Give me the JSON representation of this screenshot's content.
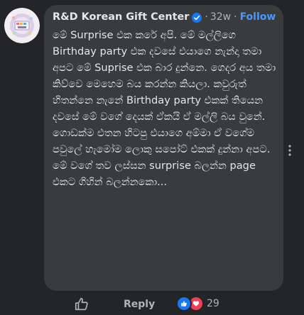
{
  "comment": {
    "author": "R&D Korean Gift Center",
    "separator": "·",
    "time_ago": "32w",
    "follow_label": "Follow",
    "text": "මේ Surprise එක කරේ අපි. මේ මල්ලිගෙ Birthday party එක දවසේ එයාගෙ නැන්දා තමා අපට මේ Suprise එක බාර දුන්නෙ. ගෙදර අය තමා කිව්වෙ මෙහෙම බය කරන්න කියලා. කවුරුත් හිතන්නෙ නැනේ Birthday party එකක් තියෙන දවසේ මේ වගේ දෙයක් ඒකයි ඒ මල්ලි බය වුනේ. ගොඩක්ම එතන හිටපු එයාගෙ අම්මා ඒ වගේම පවුලේ හැමෝම ලොකු සපෝට් එකක් දුන්නා අපට. මේ වගේ තව ලස්සන surprise බලන්න page එකට ගිහින් බලන්නකො..."
  },
  "actions": {
    "reply_label": "Reply",
    "reaction_count": "29"
  },
  "colors": {
    "background": "#242526",
    "bubble": "#3a3b3c",
    "primary_text": "#e4e6eb",
    "secondary_text": "#b0b3b8",
    "follow": "#4599ff",
    "like_blue": "#1877f2",
    "love_red": "#f33e58"
  },
  "icons": {
    "avatar": "brand-logo-avatar",
    "verified": "verified-badge-icon",
    "more": "more-options-icon",
    "like": "thumbs-up-icon",
    "reaction_like": "like-reaction-icon",
    "reaction_love": "love-reaction-icon"
  }
}
